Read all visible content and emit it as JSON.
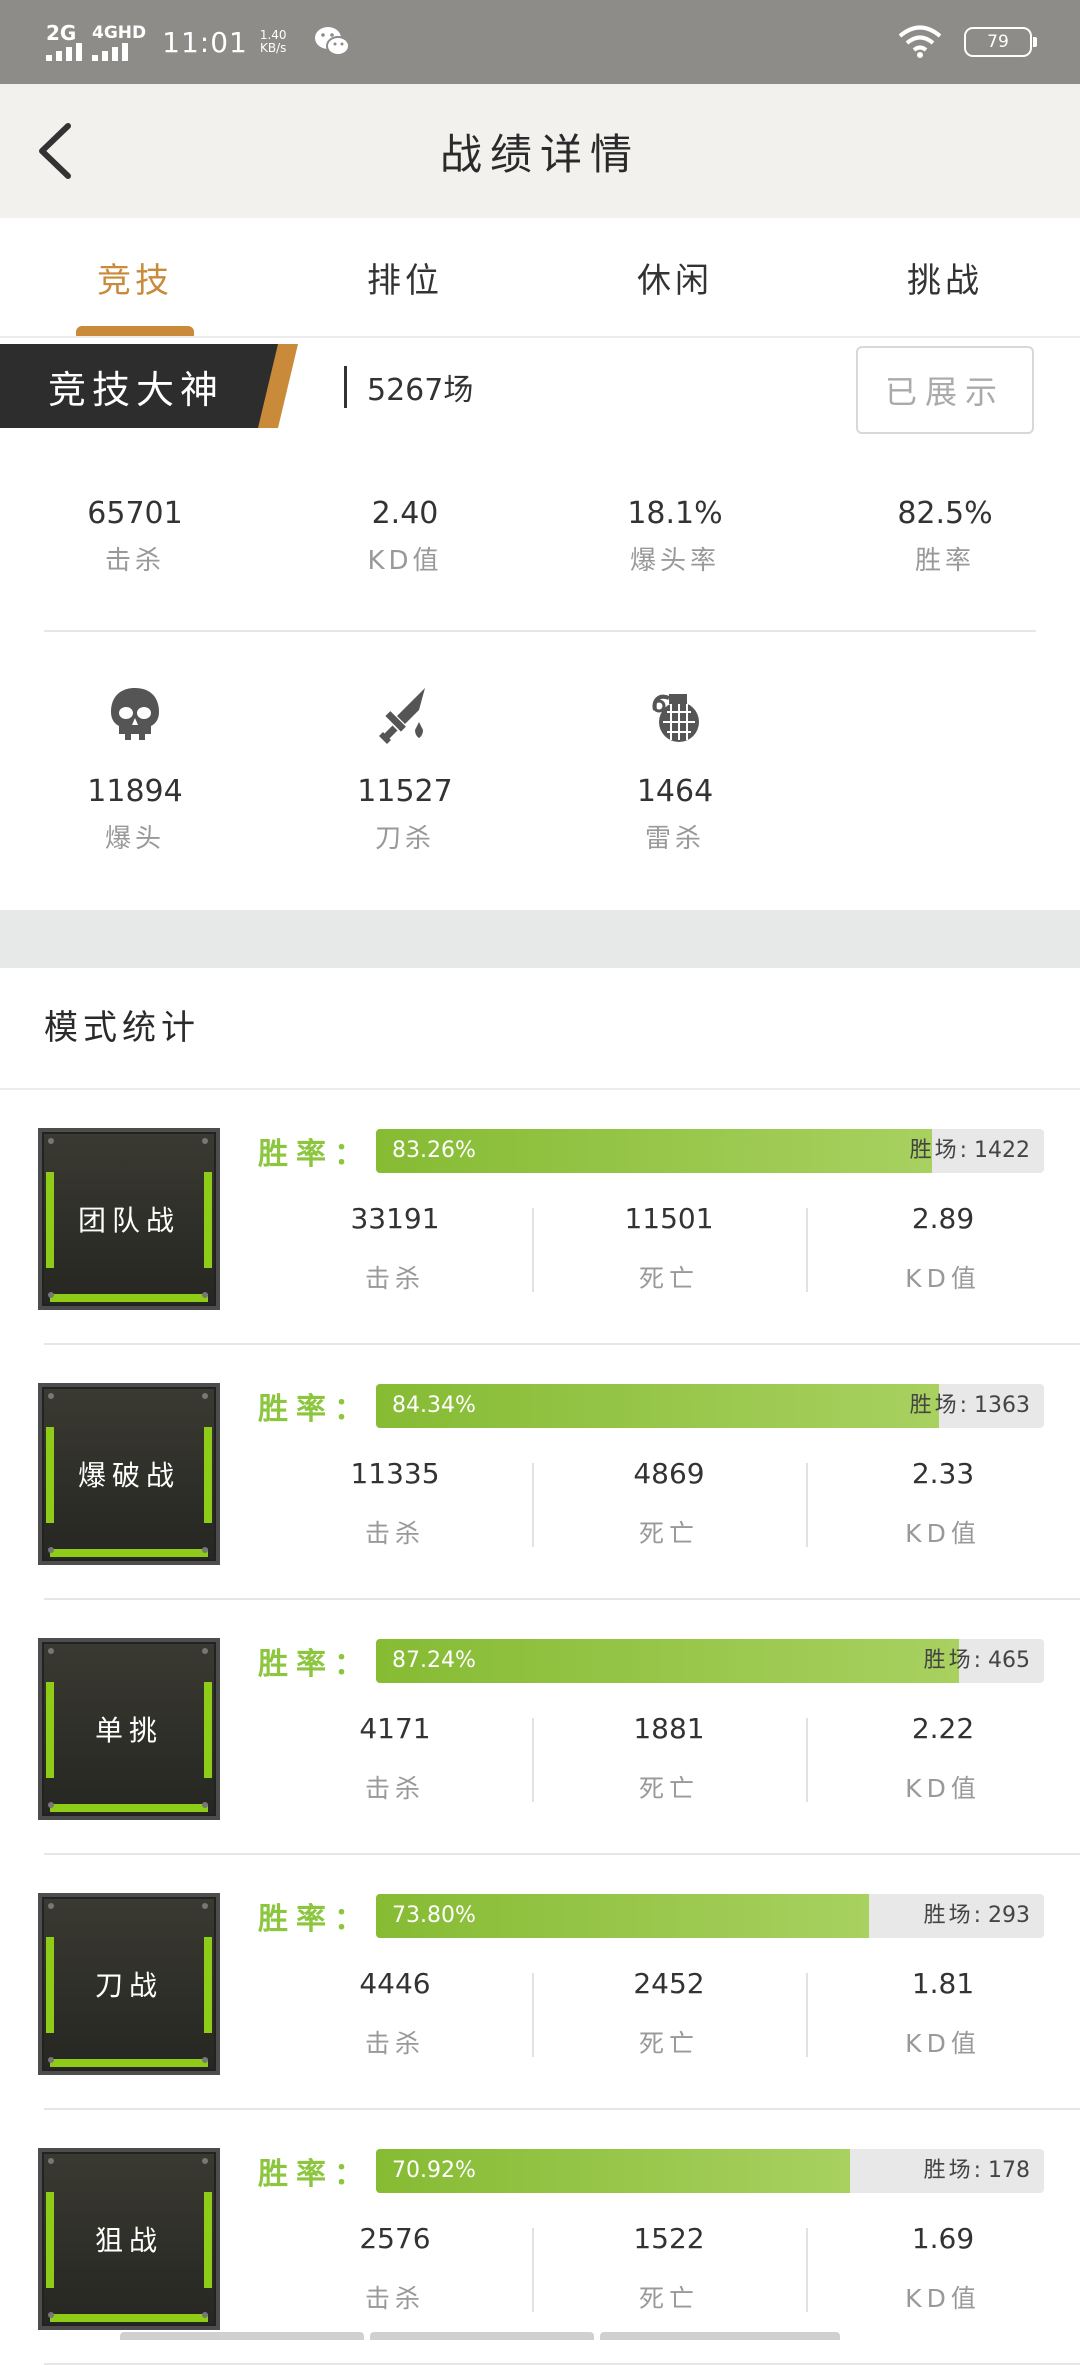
{
  "status_bar": {
    "network1": "2G",
    "network2": "4GHD",
    "time": "11:01",
    "speed_value": "1.40",
    "speed_unit": "KB/s",
    "battery": "79"
  },
  "header": {
    "title": "战绩详情"
  },
  "tabs": [
    {
      "label": "竞技",
      "active": true
    },
    {
      "label": "排位",
      "active": false
    },
    {
      "label": "休闲",
      "active": false
    },
    {
      "label": "挑战",
      "active": false
    }
  ],
  "rank": {
    "title": "竞技大神",
    "games": "5267场",
    "show_button": "已展示"
  },
  "summary": [
    {
      "value": "65701",
      "label": "击杀"
    },
    {
      "value": "2.40",
      "label": "KD值"
    },
    {
      "value": "18.1%",
      "label": "爆头率"
    },
    {
      "value": "82.5%",
      "label": "胜率"
    }
  ],
  "special": [
    {
      "icon": "skull-icon",
      "value": "11894",
      "label": "爆头"
    },
    {
      "icon": "knife-icon",
      "value": "11527",
      "label": "刀杀"
    },
    {
      "icon": "grenade-icon",
      "value": "1464",
      "label": "雷杀"
    }
  ],
  "section_title": "模式统计",
  "win_label": "胜率：",
  "wins_label": "胜场",
  "stat_labels": {
    "kills": "击杀",
    "deaths": "死亡",
    "kd": "KD值"
  },
  "modes": [
    {
      "name": "团队战",
      "win_rate": "83.26%",
      "win_fraction": 0.8326,
      "wins": "1422",
      "kills": "33191",
      "deaths": "11501",
      "kd": "2.89"
    },
    {
      "name": "爆破战",
      "win_rate": "84.34%",
      "win_fraction": 0.8434,
      "wins": "1363",
      "kills": "11335",
      "deaths": "4869",
      "kd": "2.33"
    },
    {
      "name": "单挑",
      "win_rate": "87.24%",
      "win_fraction": 0.8724,
      "wins": "465",
      "kills": "4171",
      "deaths": "1881",
      "kd": "2.22"
    },
    {
      "name": "刀战",
      "win_rate": "73.80%",
      "win_fraction": 0.738,
      "wins": "293",
      "kills": "4446",
      "deaths": "2452",
      "kd": "1.81"
    },
    {
      "name": "狙战",
      "win_rate": "70.92%",
      "win_fraction": 0.7092,
      "wins": "178",
      "kills": "2576",
      "deaths": "1522",
      "kd": "1.69"
    }
  ],
  "colors": {
    "accent": "#c98a3a",
    "green": "#8cc63f",
    "status_bar": "#8e8c89"
  }
}
